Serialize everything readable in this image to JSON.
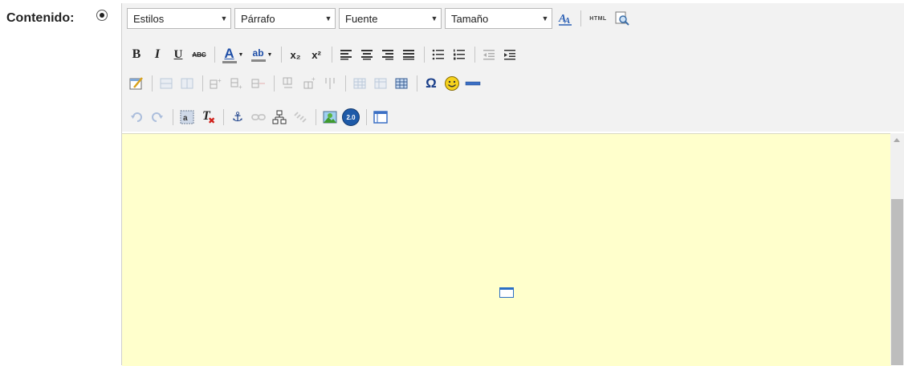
{
  "form": {
    "label": "Contenido:"
  },
  "toolbar": {
    "combos": {
      "styles": "Estilos",
      "format": "Párrafo",
      "font": "Fuente",
      "size": "Tamaño"
    },
    "buttons": {
      "html_label": "HTML",
      "bold": "B",
      "italic": "I",
      "underline": "U",
      "strike": "ABC",
      "text_color": "A",
      "bg_color": "ab",
      "subscript": "x₂",
      "superscript": "x²",
      "omega": "Ω",
      "clear_format": "T",
      "anchor": "⚓",
      "version_badge": "2.0"
    }
  },
  "colors": {
    "content_bg": "#ffffcc",
    "toolbar_bg": "#f2f2f2",
    "accent_blue": "#2b6fc4"
  }
}
